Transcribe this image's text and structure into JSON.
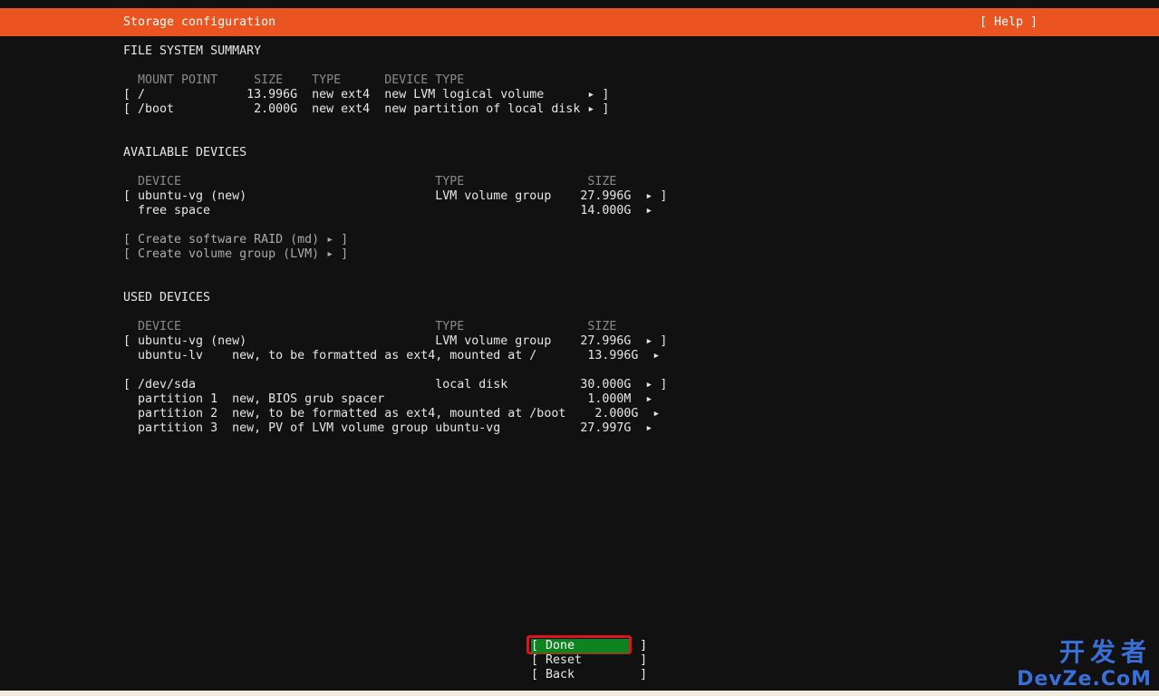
{
  "header": {
    "title": "Storage configuration",
    "help": "[ Help ]"
  },
  "fs_summary": {
    "heading": "FILE SYSTEM SUMMARY",
    "columns": "  MOUNT POINT     SIZE    TYPE      DEVICE TYPE",
    "rows": [
      "[ /              13.996G  new ext4  new LVM logical volume      ▸ ]",
      "[ /boot           2.000G  new ext4  new partition of local disk ▸ ]"
    ]
  },
  "available": {
    "heading": "AVAILABLE DEVICES",
    "columns": "  DEVICE                                   TYPE                 SIZE",
    "rows": [
      "[ ubuntu-vg (new)                          LVM volume group    27.996G  ▸ ]",
      "  free space                                                   14.000G  ▸"
    ],
    "actions": [
      "[ Create software RAID (md) ▸ ]",
      "[ Create volume group (LVM) ▸ ]"
    ]
  },
  "used": {
    "heading": "USED DEVICES",
    "columns": "  DEVICE                                   TYPE                 SIZE",
    "rows": [
      "[ ubuntu-vg (new)                          LVM volume group    27.996G  ▸ ]",
      "  ubuntu-lv    new, to be formatted as ext4, mounted at /       13.996G  ▸",
      "[ /dev/sda                                 local disk          30.000G  ▸ ]",
      "  partition 1  new, BIOS grub spacer                            1.000M  ▸",
      "  partition 2  new, to be formatted as ext4, mounted at /boot    2.000G  ▸",
      "  partition 3  new, PV of LVM volume group ubuntu-vg           27.997G  ▸"
    ]
  },
  "buttons": {
    "done": "[ Done         ]",
    "reset": "[ Reset        ]",
    "back": "[ Back         ]"
  },
  "watermark": {
    "line1": "开发者",
    "line2": "DevZe.CoM"
  },
  "colors": {
    "accent": "#e95420",
    "done_bg": "#0e8420",
    "focus": "#e0121a",
    "background": "#111111"
  }
}
